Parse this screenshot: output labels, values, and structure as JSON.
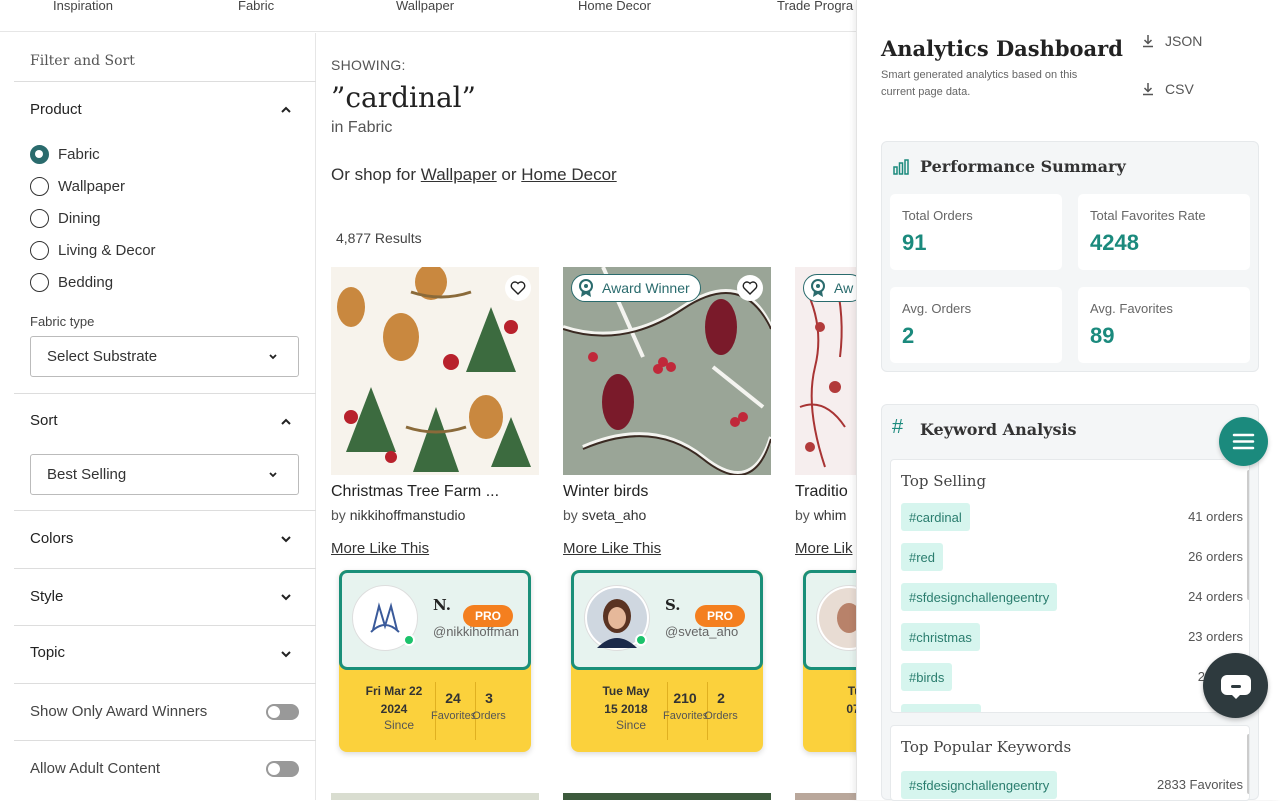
{
  "topnav": [
    "Inspiration",
    "Fabric",
    "Wallpaper",
    "Home Decor",
    "Trade Progra"
  ],
  "sidebar": {
    "title": "Filter and Sort",
    "product": {
      "heading": "Product",
      "options": [
        "Fabric",
        "Wallpaper",
        "Dining",
        "Living & Decor",
        "Bedding"
      ],
      "selected": "Fabric"
    },
    "fabric_type_label": "Fabric type",
    "substrate_select": "Select Substrate",
    "sort": {
      "heading": "Sort",
      "selected": "Best Selling"
    },
    "colors": "Colors",
    "style": "Style",
    "topic": "Topic",
    "award_toggle": "Show Only Award Winners",
    "adult_toggle": "Allow Adult Content"
  },
  "main": {
    "showing": "SHOWING:",
    "query": "”cardinal”",
    "in_category": "in Fabric",
    "or_shop_prefix": "Or shop for",
    "or_link_1": "Wallpaper",
    "or_sep": "or",
    "or_link_2": "Home Decor",
    "results": "4,877 Results",
    "cards": [
      {
        "title": "Christmas Tree Farm ...",
        "by": "by",
        "author": "nikkihoffmanstudio",
        "more": "More Like This",
        "award": ""
      },
      {
        "title": "Winter birds",
        "by": "by",
        "author": "sveta_aho",
        "more": "More Like This",
        "award": "Award Winner"
      },
      {
        "title": "Traditio",
        "by": "by",
        "author": "whim",
        "more": "More Lik",
        "award": "Aw"
      }
    ],
    "designers": [
      {
        "initial": "N.",
        "handle": "@nikkihoffman",
        "pro": "PRO",
        "since_date_1": "Fri Mar 22",
        "since_date_2": "2024",
        "since": "Since",
        "favorites": "24",
        "favorites_label": "Favorites",
        "orders": "3",
        "orders_label": "Orders"
      },
      {
        "initial": "S.",
        "handle": "@sveta_aho",
        "pro": "PRO",
        "since_date_1": "Tue May",
        "since_date_2": "15 2018",
        "since": "Since",
        "favorites": "210",
        "favorites_label": "Favorites",
        "orders": "2",
        "orders_label": "Orders"
      },
      {
        "initial": "",
        "handle": "",
        "pro": "",
        "since_date_1": "Tue",
        "since_date_2": "07 2",
        "since": "S",
        "favorites": "",
        "favorites_label": "",
        "orders": "",
        "orders_label": ""
      }
    ]
  },
  "panel": {
    "title": "Analytics Dashboard",
    "subtitle": "Smart generated analytics based on this current page data.",
    "json_btn": "JSON",
    "csv_btn": "CSV",
    "performance": {
      "heading": "Performance Summary",
      "total_orders_label": "Total Orders",
      "total_orders": "91",
      "total_fav_label": "Total Favorites Rate",
      "total_fav": "4248",
      "avg_orders_label": "Avg. Orders",
      "avg_orders": "2",
      "avg_fav_label": "Avg. Favorites",
      "avg_fav": "89"
    },
    "keywords": {
      "heading": "Keyword Analysis",
      "top_selling_label": "Top Selling",
      "top_selling": [
        {
          "tag": "#cardinal",
          "value": "41 orders"
        },
        {
          "tag": "#red",
          "value": "26 orders"
        },
        {
          "tag": "#sfdesignchallengeentry",
          "value": "24 orders"
        },
        {
          "tag": "#christmas",
          "value": "23 orders"
        },
        {
          "tag": "#birds",
          "value": "21 o"
        }
      ],
      "top_popular_label": "Top Popular Keywords",
      "top_popular": [
        {
          "tag": "#sfdesignchallengeentry",
          "value": "2833 Favorites"
        }
      ]
    }
  },
  "colors": {
    "accent": "#1b8a7d",
    "pro": "#f47f1f",
    "designer_bottom": "#fbd13c"
  }
}
